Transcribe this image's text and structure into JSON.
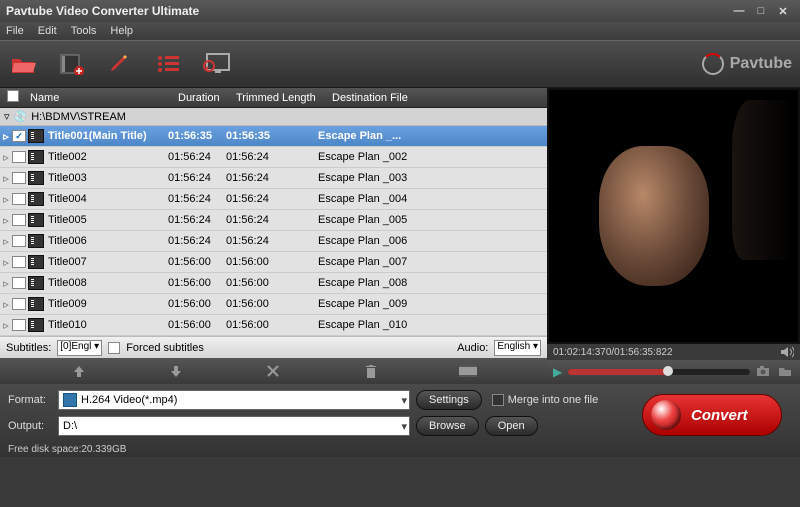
{
  "window": {
    "title": "Pavtube Video Converter Ultimate"
  },
  "menu": {
    "file": "File",
    "edit": "Edit",
    "tools": "Tools",
    "help": "Help"
  },
  "brand": "Pavtube",
  "table": {
    "headers": {
      "name": "Name",
      "duration": "Duration",
      "trimmed": "Trimmed Length",
      "dest": "Destination File"
    },
    "source": "H:\\BDMV\\STREAM",
    "rows": [
      {
        "checked": true,
        "selected": true,
        "name": "Title001(Main Title)",
        "duration": "01:56:35",
        "trimmed": "01:56:35",
        "dest": "Escape Plan _..."
      },
      {
        "checked": false,
        "selected": false,
        "name": "Title002",
        "duration": "01:56:24",
        "trimmed": "01:56:24",
        "dest": "Escape Plan _002"
      },
      {
        "checked": false,
        "selected": false,
        "name": "Title003",
        "duration": "01:56:24",
        "trimmed": "01:56:24",
        "dest": "Escape Plan _003"
      },
      {
        "checked": false,
        "selected": false,
        "name": "Title004",
        "duration": "01:56:24",
        "trimmed": "01:56:24",
        "dest": "Escape Plan _004"
      },
      {
        "checked": false,
        "selected": false,
        "name": "Title005",
        "duration": "01:56:24",
        "trimmed": "01:56:24",
        "dest": "Escape Plan _005"
      },
      {
        "checked": false,
        "selected": false,
        "name": "Title006",
        "duration": "01:56:24",
        "trimmed": "01:56:24",
        "dest": "Escape Plan _006"
      },
      {
        "checked": false,
        "selected": false,
        "name": "Title007",
        "duration": "01:56:00",
        "trimmed": "01:56:00",
        "dest": "Escape Plan _007"
      },
      {
        "checked": false,
        "selected": false,
        "name": "Title008",
        "duration": "01:56:00",
        "trimmed": "01:56:00",
        "dest": "Escape Plan _008"
      },
      {
        "checked": false,
        "selected": false,
        "name": "Title009",
        "duration": "01:56:00",
        "trimmed": "01:56:00",
        "dest": "Escape Plan _009"
      },
      {
        "checked": false,
        "selected": false,
        "name": "Title010",
        "duration": "01:56:00",
        "trimmed": "01:56:00",
        "dest": "Escape Plan _010"
      }
    ]
  },
  "subtitles": {
    "label": "Subtitles:",
    "value": "[0]Engl",
    "forced": "Forced subtitles"
  },
  "audio": {
    "label": "Audio:",
    "value": "English"
  },
  "preview": {
    "time": "01:02:14:370/01:56:35:822"
  },
  "format": {
    "label": "Format:",
    "value": "H.264 Video(*.mp4)",
    "settings": "Settings",
    "merge": "Merge into one file"
  },
  "output": {
    "label": "Output:",
    "value": "D:\\",
    "browse": "Browse",
    "open": "Open"
  },
  "convert": "Convert",
  "freedisk": "Free disk space:20.339GB"
}
